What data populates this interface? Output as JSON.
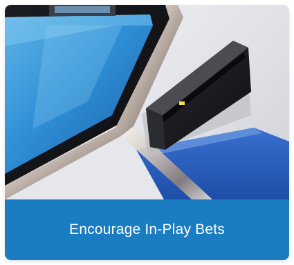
{
  "card": {
    "caption": "Encourage In-Play Bets",
    "caption_bar_color": "#1a7cc1",
    "image_subject": "betting-terminal-card-reader"
  }
}
